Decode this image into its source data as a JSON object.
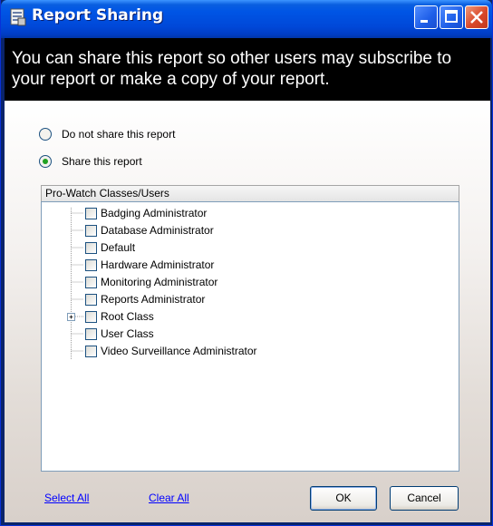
{
  "window": {
    "title": "Report Sharing"
  },
  "banner": {
    "text": "You can share this report so other users may subscribe to your report or make a copy of your report."
  },
  "sharing_options": [
    {
      "label": "Do not share this report",
      "selected": false
    },
    {
      "label": "Share this report",
      "selected": true
    }
  ],
  "classes_panel": {
    "header": "Pro-Watch Classes/Users",
    "items": [
      {
        "label": "Badging Administrator",
        "checked": false,
        "expandable": false
      },
      {
        "label": "Database Administrator",
        "checked": false,
        "expandable": false
      },
      {
        "label": "Default",
        "checked": false,
        "expandable": false
      },
      {
        "label": "Hardware Administrator",
        "checked": false,
        "expandable": false
      },
      {
        "label": "Monitoring Administrator",
        "checked": false,
        "expandable": false
      },
      {
        "label": "Reports Administrator",
        "checked": false,
        "expandable": false
      },
      {
        "label": "Root Class",
        "checked": false,
        "expandable": true
      },
      {
        "label": "User Class",
        "checked": false,
        "expandable": false
      },
      {
        "label": "Video Surveillance Administrator",
        "checked": false,
        "expandable": false
      }
    ]
  },
  "footer": {
    "select_all": "Select All",
    "clear_all": "Clear All",
    "ok": "OK",
    "cancel": "Cancel"
  },
  "colors": {
    "titlebar": "#0055e5",
    "banner": "#000000",
    "link": "#0000ff",
    "radio_selected": "#21a121"
  }
}
